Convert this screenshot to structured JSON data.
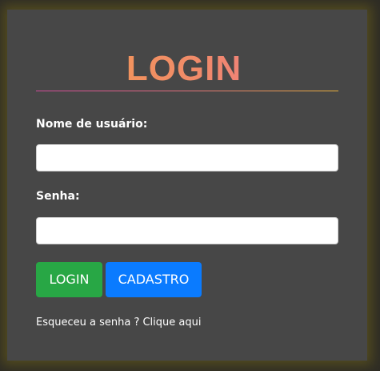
{
  "login_form": {
    "title": "LOGIN",
    "username_label": "Nome de usuário:",
    "username_value": "",
    "password_label": "Senha:",
    "password_value": "",
    "login_button": "LOGIN",
    "register_button": "CADASTRO",
    "forgot_prefix": "Esqueceu a senha ?",
    "forgot_link": "Clique aqui"
  },
  "colors": {
    "card_background": "#474747",
    "login_button": "#28a745",
    "register_button": "#0a7bff",
    "title_gradient_start": "#f5a04a",
    "title_gradient_end": "#f06e9a"
  }
}
